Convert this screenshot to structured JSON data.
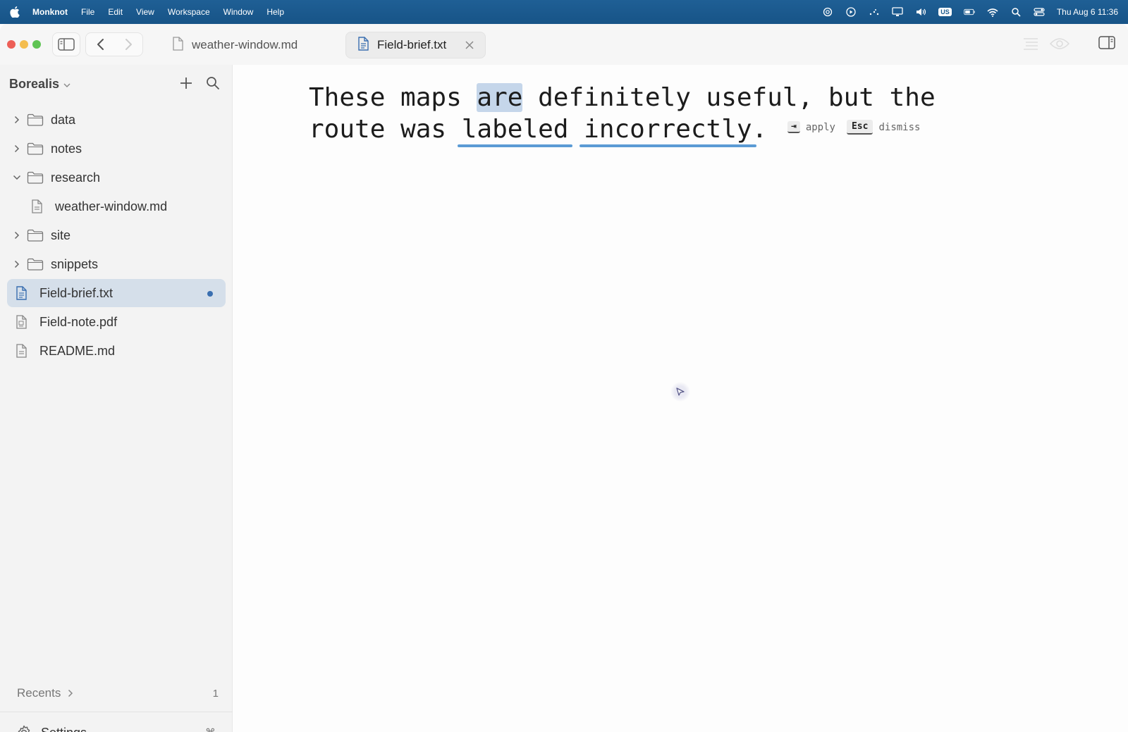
{
  "menubar": {
    "app_name": "Monknot",
    "menus": [
      "File",
      "Edit",
      "View",
      "Workspace",
      "Window",
      "Help"
    ],
    "keyboard_layout": "US",
    "clock": "Thu Aug 6  11:36",
    "status_icons": [
      "chatgpt-icon",
      "play-icon",
      "dots-icon",
      "display-icon",
      "volume-icon",
      "keyboard-layout-badge",
      "battery-icon",
      "wifi-icon",
      "spotlight-icon",
      "control-center-icon"
    ]
  },
  "tabs": [
    {
      "label": "weather-window.md",
      "active": false
    },
    {
      "label": "Field-brief.txt",
      "active": true
    }
  ],
  "sidebar": {
    "vault_name": "Borealis",
    "tree": [
      {
        "label": "data",
        "type": "folder",
        "expanded": false
      },
      {
        "label": "notes",
        "type": "folder",
        "expanded": false
      },
      {
        "label": "research",
        "type": "folder",
        "expanded": true
      },
      {
        "label": "weather-window.md",
        "type": "file"
      },
      {
        "label": "site",
        "type": "folder",
        "expanded": false
      },
      {
        "label": "snippets",
        "type": "folder",
        "expanded": false
      },
      {
        "label": "Field-brief.txt",
        "type": "file",
        "active": true,
        "unsaved": true
      },
      {
        "label": "Field-note.pdf",
        "type": "pdf"
      },
      {
        "label": "README.md",
        "type": "file"
      }
    ],
    "recents_label": "Recents",
    "recents_count": "1",
    "settings_label": "Settings",
    "settings_shortcut": "⌘,"
  },
  "editor": {
    "line1": {
      "before": "These maps ",
      "selected": "are",
      "after": " definitely useful, but the"
    },
    "line2": {
      "before": "route was ",
      "flag1": "labeled",
      "between": " ",
      "flag2": "incorrectly",
      "after": "."
    },
    "hint": {
      "apply_key": "⇥",
      "apply_label": "apply",
      "dismiss_key": "Esc",
      "dismiss_label": "dismiss"
    }
  },
  "colors": {
    "menubar": "#1b5a8e",
    "accent": "#3a6fb0",
    "selection": "#c5d6ea",
    "underline": "#5b9bd5",
    "active_row": "#d5dfea"
  }
}
